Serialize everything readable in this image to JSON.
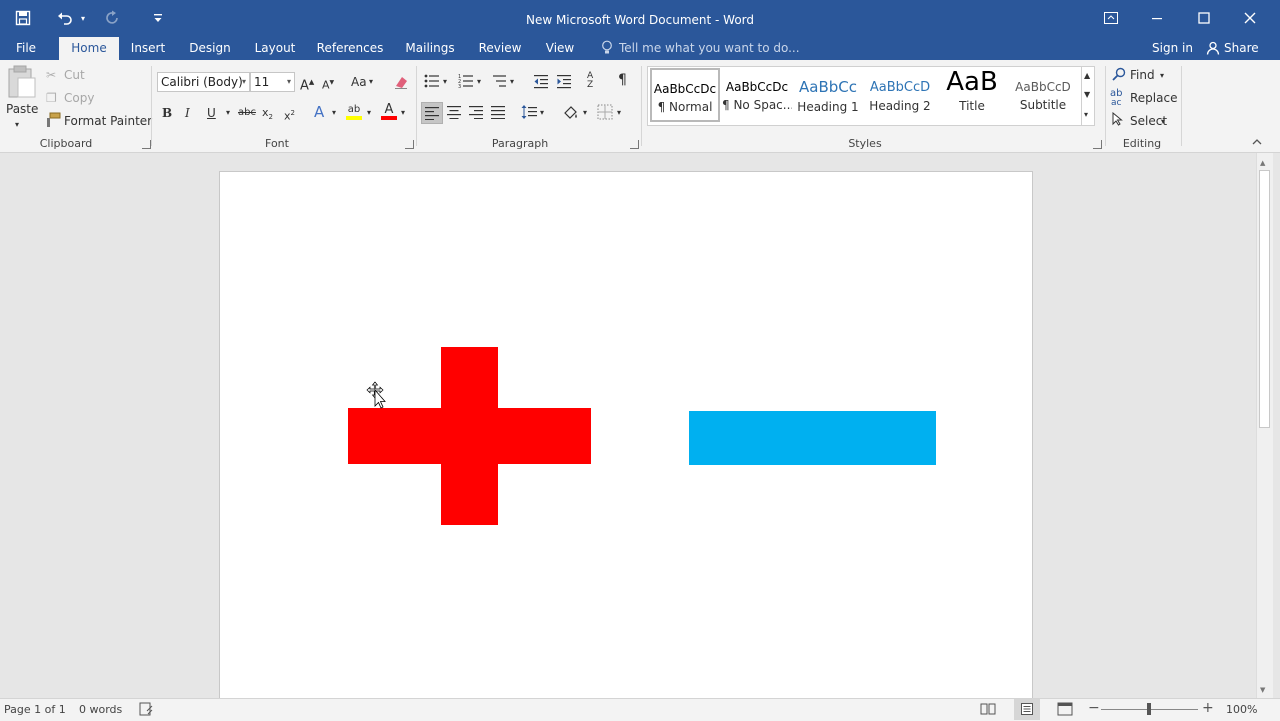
{
  "window": {
    "title": "New Microsoft Word Document - Word",
    "sign_in": "Sign in",
    "share": "Share"
  },
  "tabs": [
    "File",
    "Home",
    "Insert",
    "Design",
    "Layout",
    "References",
    "Mailings",
    "Review",
    "View"
  ],
  "tell_me": "Tell me what you want to do...",
  "clipboard": {
    "paste": "Paste",
    "cut": "Cut",
    "copy": "Copy",
    "format_painter": "Format Painter",
    "label": "Clipboard"
  },
  "font": {
    "name": "Calibri (Body)",
    "size": "11",
    "change_case": "Aa",
    "label": "Font"
  },
  "paragraph": {
    "label": "Paragraph"
  },
  "styles": {
    "label": "Styles",
    "items": [
      {
        "sample": "AaBbCcDc",
        "name": "¶ Normal"
      },
      {
        "sample": "AaBbCcDc",
        "name": "¶ No Spac..."
      },
      {
        "sample": "AaBbCc",
        "name": "Heading 1"
      },
      {
        "sample": "AaBbCcD",
        "name": "Heading 2"
      },
      {
        "sample": "AaB",
        "name": "Title"
      },
      {
        "sample": "AaBbCcD",
        "name": "Subtitle"
      }
    ]
  },
  "editing": {
    "find": "Find",
    "replace": "Replace",
    "select": "Select",
    "label": "Editing"
  },
  "shapes": {
    "plus_color": "#ff0000",
    "minus_color": "#00b0f0"
  },
  "status": {
    "page": "Page 1 of 1",
    "words": "0 words",
    "zoom": "100%"
  },
  "colors": {
    "brand": "#2b579a",
    "ribbon_bg": "#f3f3f3",
    "highlight": "#ffff00",
    "font_color": "#ff0000"
  }
}
